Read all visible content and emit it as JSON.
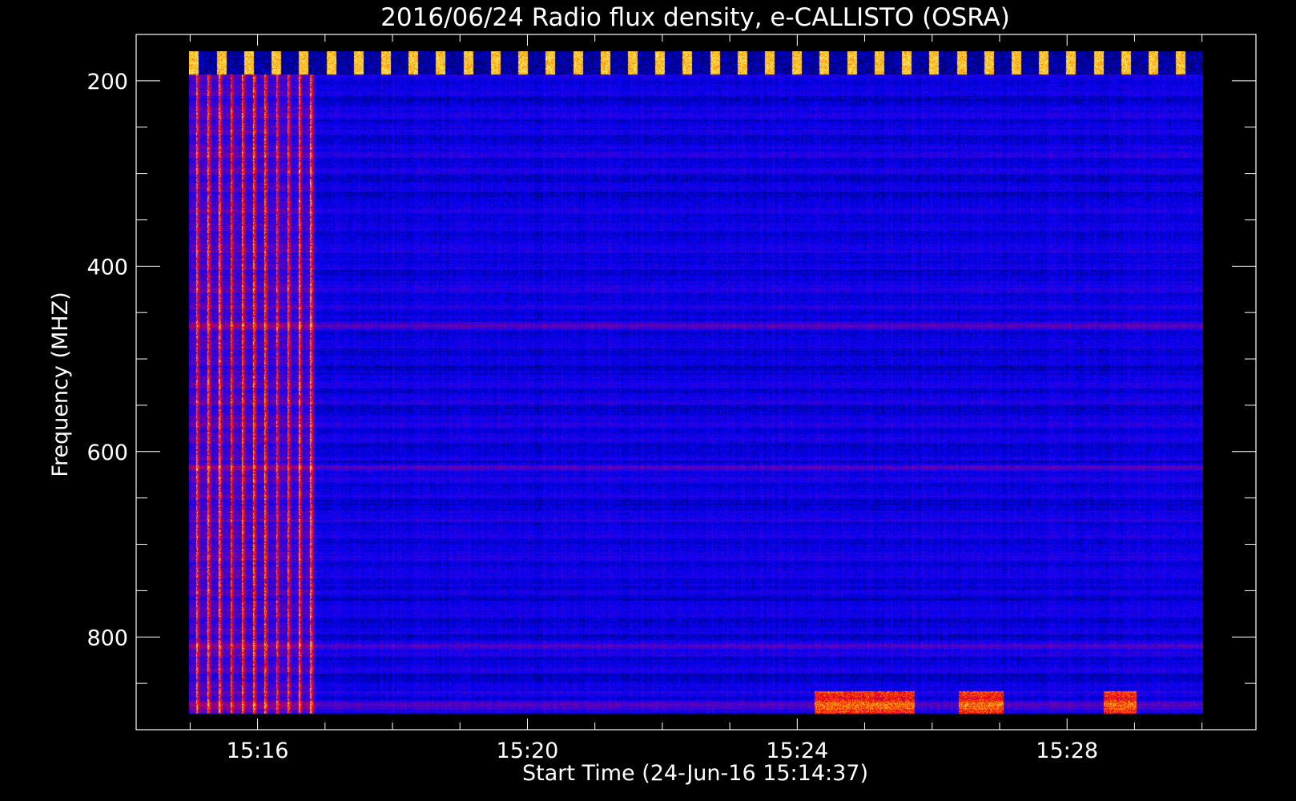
{
  "chart_data": {
    "type": "heatmap",
    "title": "2016/06/24  Radio flux density, e-CALLISTO (OSRA)",
    "xlabel": "Start Time (24-Jun-16 15:14:37)",
    "ylabel": "Frequency (MHZ)",
    "x_tick_labels": [
      "15:16",
      "15:20",
      "15:24",
      "15:28"
    ],
    "x_major_minutes": [
      16,
      20,
      24,
      28
    ],
    "x_minor_minutes": [
      15,
      16,
      17,
      18,
      19,
      20,
      21,
      22,
      23,
      24,
      25,
      26,
      27,
      28,
      29,
      30
    ],
    "xlim_minutes_after_1500": [
      14.2,
      30.8
    ],
    "y_tick_labels": [
      "200",
      "400",
      "600",
      "800"
    ],
    "y_major": [
      200,
      400,
      600,
      800
    ],
    "y_minor": [
      250,
      300,
      350,
      450,
      500,
      550,
      650,
      700,
      750,
      850
    ],
    "ylim": [
      150,
      900
    ],
    "y_inverted": true,
    "data_extent": {
      "time_start": "15:14:37",
      "time_end": "15:29:50",
      "freq_min_mhz": 145,
      "freq_max_mhz": 870
    },
    "colormap": [
      "#000000",
      "#0000ff",
      "#8000a0",
      "#ff0000",
      "#ffa000",
      "#ffff80"
    ],
    "features": [
      {
        "kind": "burst",
        "time_start": "15:14:37",
        "time_end": "15:16:30",
        "freq_range": [
          160,
          870
        ],
        "intensity": "high"
      },
      {
        "kind": "periodic_calibration_pulses",
        "freq_range": [
          145,
          170
        ]
      },
      {
        "kind": "rfi_band",
        "freq": 446,
        "intensity": "medium"
      },
      {
        "kind": "rfi_band",
        "freq": 600,
        "intensity": "medium"
      },
      {
        "kind": "rfi_band",
        "freq": 795,
        "intensity": "medium"
      },
      {
        "kind": "rfi_band",
        "freq": 860,
        "intensity": "medium"
      },
      {
        "kind": "enhancement",
        "time_start": "15:24:00",
        "time_end": "15:25:30",
        "freq_range": [
          845,
          870
        ],
        "intensity": "high"
      },
      {
        "kind": "enhancement",
        "time_start": "15:26:10",
        "time_end": "15:26:50",
        "freq_range": [
          845,
          870
        ],
        "intensity": "high"
      },
      {
        "kind": "enhancement",
        "time_start": "15:28:20",
        "time_end": "15:28:50",
        "freq_range": [
          845,
          870
        ],
        "intensity": "high"
      }
    ]
  }
}
